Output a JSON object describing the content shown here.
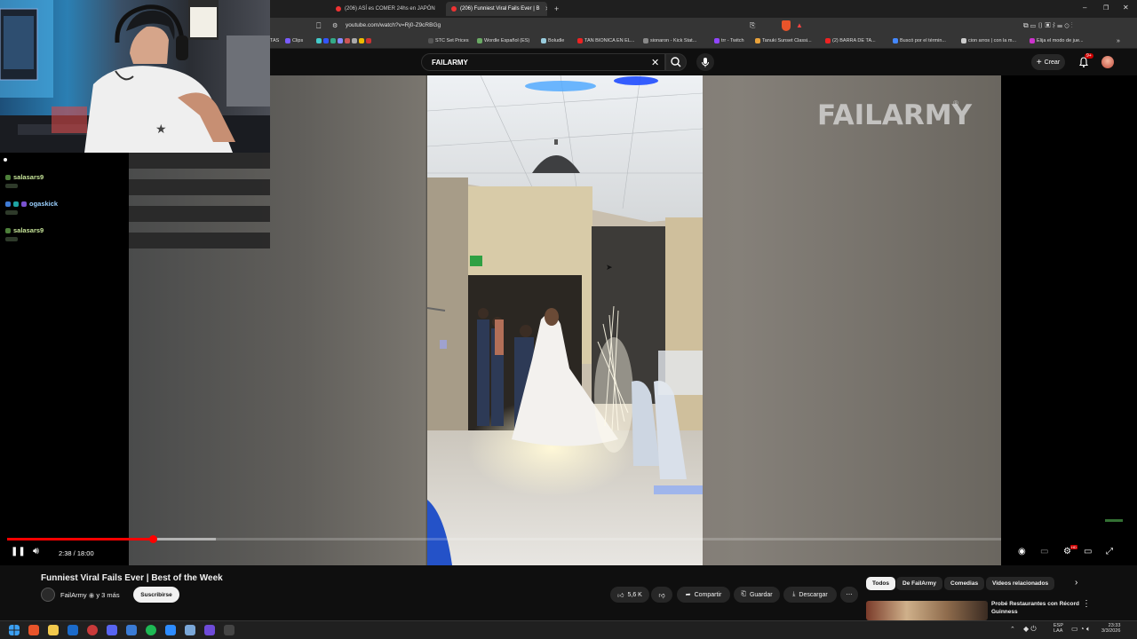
{
  "browser": {
    "tabs": [
      {
        "label": "(206) ASÍ es COMER 24hs en JAPÓN",
        "active": false
      },
      {
        "label": "(206) Funniest Viral Fails Ever | B",
        "active": true
      }
    ],
    "url": "youtube.com/watch?v=Rj0-Z9cRBGg",
    "bookmarks": [
      "TAS",
      "Clips",
      "STC Set Prices",
      "Wordle Español (ES)",
      "Boludle",
      "TAN BIONICA EN EL...",
      "sionaron - Kick Stat...",
      "trr - Twitch",
      "Tanuki Sunset Classi...",
      "(2) BARRA DE TA...",
      "Buscó por el términ...",
      "cion arros | con la m...",
      "Elija el modo de jue..."
    ]
  },
  "youtube": {
    "search_value": "FAILARMY",
    "create_label": "Crear",
    "notification_count": "9+"
  },
  "chat": {
    "messages": [
      {
        "user": "salasars9",
        "color": "#c8e69a"
      },
      {
        "user": "ogaskick",
        "color": "#9ad0ff"
      },
      {
        "user": "salasars9",
        "color": "#c8e69a"
      }
    ]
  },
  "player": {
    "watermark": "FAILARMY",
    "time_display": "2:38 / 18:00",
    "progress_played": 0.1467,
    "progress_buffered": 0.21,
    "icons": [
      "pause-icon",
      "volume-icon",
      "autoplay-icon",
      "subtitles-icon",
      "settings-icon",
      "theater-icon",
      "fullscreen-icon"
    ],
    "settings_badge": "HD"
  },
  "video_info": {
    "title": "Funniest Viral Fails Ever | Best of the Week",
    "channel": "FailArmy",
    "channel_suffix": "y 3 más",
    "subscribe_label": "Suscribirse",
    "likes": "5,6 K",
    "share_label": "Compartir",
    "save_label": "Guardar",
    "download_label": "Descargar"
  },
  "recommendations": {
    "chips": [
      "Todos",
      "De FailArmy",
      "Comedias",
      "Videos relacionados"
    ],
    "first_title": "Probé Restaurantes con Récord Guinness"
  },
  "taskbar": {
    "lang": "ESP",
    "lang2": "LAA",
    "time": "23:33",
    "date": "3/3/2026"
  },
  "colors": {
    "accent": "#ff0000",
    "background": "#0f0f0f"
  }
}
